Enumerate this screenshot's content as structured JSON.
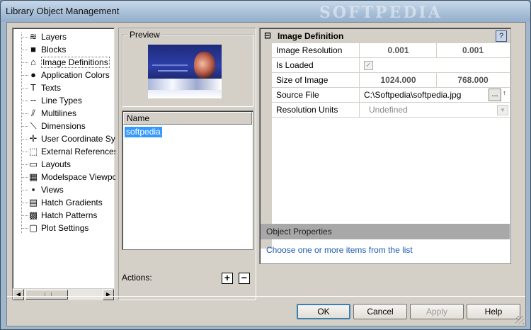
{
  "window": {
    "title": "Library Object Management",
    "watermark": "SOFTPEDIA"
  },
  "tree": {
    "items": [
      {
        "label": "Layers",
        "icon": "layers-icon",
        "glyph": "≋"
      },
      {
        "label": "Blocks",
        "icon": "blocks-icon",
        "glyph": "■"
      },
      {
        "label": "Image Definitions",
        "icon": "image-definitions-icon",
        "glyph": "⌂"
      },
      {
        "label": "Application Colors",
        "icon": "application-colors-icon",
        "glyph": "●"
      },
      {
        "label": "Texts",
        "icon": "texts-icon",
        "glyph": "T"
      },
      {
        "label": "Line Types",
        "icon": "line-types-icon",
        "glyph": "╌"
      },
      {
        "label": "Multilines",
        "icon": "multilines-icon",
        "glyph": "⫽"
      },
      {
        "label": "Dimensions",
        "icon": "dimensions-icon",
        "glyph": "⟍"
      },
      {
        "label": "User Coordinate Sy",
        "icon": "user-coordinate-system-icon",
        "glyph": "✛"
      },
      {
        "label": "External References",
        "icon": "external-references-icon",
        "glyph": "⬚"
      },
      {
        "label": "Layouts",
        "icon": "layouts-icon",
        "glyph": "▭"
      },
      {
        "label": "Modelspace Viewpo",
        "icon": "modelspace-viewports-icon",
        "glyph": "▦"
      },
      {
        "label": "Views",
        "icon": "views-icon",
        "glyph": "▪"
      },
      {
        "label": "Hatch Gradients",
        "icon": "hatch-gradients-icon",
        "glyph": "▤"
      },
      {
        "label": "Hatch Patterns",
        "icon": "hatch-patterns-icon",
        "glyph": "▩"
      },
      {
        "label": "Plot Settings",
        "icon": "plot-settings-icon",
        "glyph": "▢"
      }
    ],
    "selected_index": 2
  },
  "preview": {
    "legend": "Preview"
  },
  "list": {
    "header": "Name",
    "rows": [
      "softpedia"
    ]
  },
  "actions": {
    "label": "Actions:",
    "add_glyph": "+",
    "remove_glyph": "−"
  },
  "properties": {
    "category": "Image Definition",
    "collapse_glyph": "⊟",
    "help_glyph": "?",
    "rows": {
      "image_resolution": {
        "name": "Image Resolution",
        "x": "0.001",
        "y": "0.001"
      },
      "is_loaded": {
        "name": "Is Loaded",
        "checked": true,
        "check_glyph": "✓"
      },
      "size_of_image": {
        "name": "Size of Image",
        "w": "1024.000",
        "h": "768.000"
      },
      "source_file": {
        "name": "Source File",
        "value": "C:\\Softpedia\\softpedia.jpg",
        "browse": "..."
      },
      "resolution_units": {
        "name": "Resolution Units",
        "value": "Undefined"
      }
    },
    "object_properties": "Object Properties",
    "hint": "Choose one or more items from the list"
  },
  "buttons": {
    "ok": "OK",
    "cancel": "Cancel",
    "apply": "Apply",
    "help": "Help"
  }
}
